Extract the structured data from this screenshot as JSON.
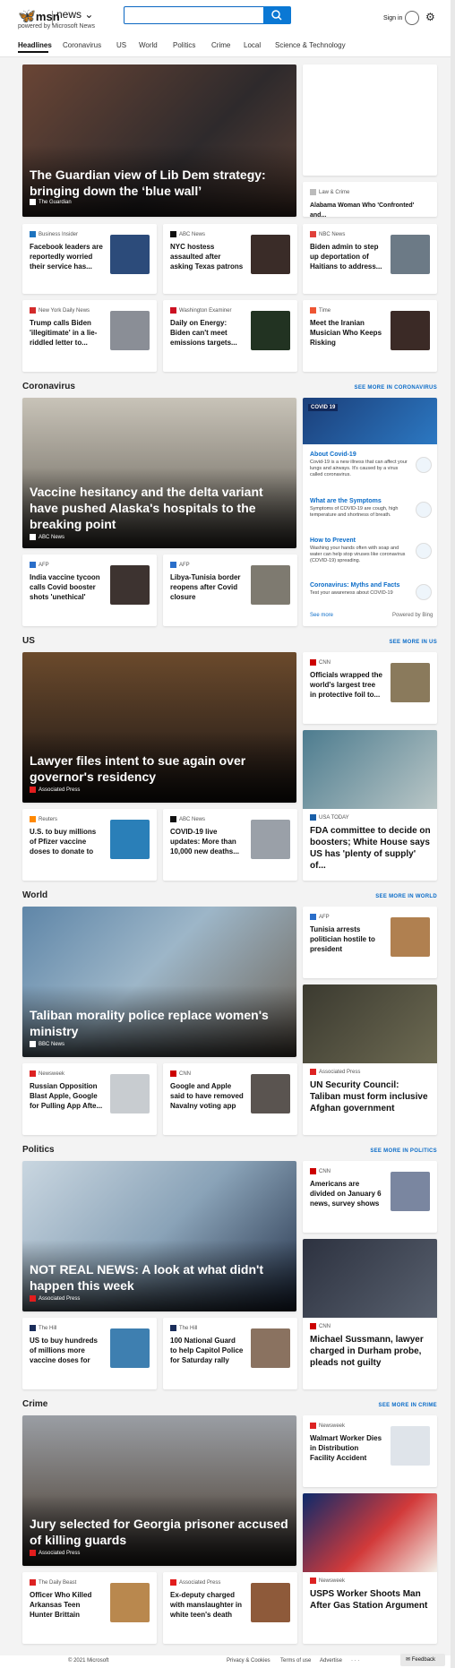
{
  "header": {
    "logo_brand": "msn",
    "logo_section": "news",
    "powered_by": "powered by Microsoft News",
    "search_value": "",
    "signin": "Sign in"
  },
  "nav": [
    "Headlines",
    "Coronavirus",
    "US",
    "World",
    "Politics",
    "Crime",
    "Local",
    "Science & Technology"
  ],
  "top": {
    "hero": {
      "title": "The Guardian view of Lib Dem strategy: bringing down the ‘blue wall’",
      "source": "The Guardian"
    },
    "side": {
      "source": "Law & Crime",
      "title": "Alabama Woman Who 'Confronted' and..."
    },
    "cards": [
      {
        "source": "Business Insider",
        "title": "Facebook leaders are reportedly worried their service has..."
      },
      {
        "source": "ABC News",
        "title": "NYC hostess assaulted after asking Texas patrons for proof of..."
      },
      {
        "source": "NBC News",
        "title": "Biden admin to step up deportation of Haitians to address..."
      },
      {
        "source": "New York Daily News",
        "title": "Trump calls Biden 'illegitimate' in a lie-riddled letter to..."
      },
      {
        "source": "Washington Examiner",
        "title": "Daily on Energy: Biden can't meet emissions targets..."
      },
      {
        "source": "Time",
        "title": "Meet the Iranian Musician Who Keeps Risking Imprisonme..."
      }
    ]
  },
  "coronavirus": {
    "heading": "Coronavirus",
    "see_more": "SEE MORE IN CORONAVIRUS",
    "hero": {
      "title": "Vaccine hesitancy and the delta variant have pushed Alaska's hospitals to the breaking point",
      "source": "ABC News"
    },
    "cards": [
      {
        "source": "AFP",
        "title": "India vaccine tycoon calls Covid booster shots 'unethical'"
      },
      {
        "source": "AFP",
        "title": "Libya-Tunisia border reopens after Covid closure"
      }
    ],
    "panel": {
      "badge": "COVID 19",
      "items": [
        {
          "h": "About Covid-19",
          "d": "Covid-19 is a new illness that can affect your lungs and airways. It's caused by a virus called coronavirus."
        },
        {
          "h": "What are the Symptoms",
          "d": "Symptoms of COVID-19 are cough, high temperature and shortness of breath."
        },
        {
          "h": "How to Prevent",
          "d": "Washing your hands often with soap and water can help stop viruses like coronavirus (COVID-19) spreading."
        },
        {
          "h": "Coronavirus: Myths and Facts",
          "d": "Test your awareness about COVID-19"
        }
      ],
      "see_more": "See more",
      "powered": "Powered by Bing"
    }
  },
  "us": {
    "heading": "US",
    "see_more": "SEE MORE IN US",
    "hero": {
      "title": "Lawyer files intent to sue again over governor's residency",
      "source": "Associated Press"
    },
    "side1": {
      "source": "CNN",
      "title": "Officials wrapped the world's largest tree in protective foil to..."
    },
    "side2": {
      "source": "USA TODAY",
      "title": "FDA committee to decide on boosters; White House says US has 'plenty of supply' of..."
    },
    "cards": [
      {
        "source": "Reuters",
        "title": "U.S. to buy millions of Pfizer vaccine doses to donate to world -..."
      },
      {
        "source": "ABC News",
        "title": "COVID-19 live updates: More than 10,000 new deaths..."
      }
    ]
  },
  "world": {
    "heading": "World",
    "see_more": "SEE MORE IN WORLD",
    "hero": {
      "title": "Taliban morality police replace women's ministry",
      "source": "BBC News"
    },
    "side1": {
      "source": "AFP",
      "title": "Tunisia arrests politician hostile to president"
    },
    "side2": {
      "source": "Associated Press",
      "title": "UN Security Council: Taliban must form inclusive Afghan government"
    },
    "cards": [
      {
        "source": "Newsweek",
        "title": "Russian Opposition Blast Apple, Google for Pulling App Afte..."
      },
      {
        "source": "CNN",
        "title": "Google and Apple said to have removed Navalny voting app ..."
      }
    ]
  },
  "politics": {
    "heading": "Politics",
    "see_more": "SEE MORE IN POLITICS",
    "hero": {
      "title": "NOT REAL NEWS: A look at what didn't happen this week",
      "source": "Associated Press"
    },
    "side1": {
      "source": "CNN",
      "title": "Americans are divided on January 6 news, survey shows"
    },
    "side2": {
      "source": "CNN",
      "title": "Michael Sussmann, lawyer charged in Durham probe, pleads not guilty"
    },
    "cards": [
      {
        "source": "The Hill",
        "title": "US to buy hundreds of millions more vaccine doses for th..."
      },
      {
        "source": "The Hill",
        "title": "100 National Guard to help Capitol Police for Saturday rally"
      }
    ]
  },
  "crime": {
    "heading": "Crime",
    "see_more": "SEE MORE IN CRIME",
    "hero": {
      "title": "Jury selected for Georgia prisoner accused of killing guards",
      "source": "Associated Press"
    },
    "side1": {
      "source": "Newsweek",
      "title": "Walmart Worker Dies in Distribution Facility Accident"
    },
    "side2": {
      "source": "Newsweek",
      "title": "USPS Worker Shoots Man After Gas Station Argument"
    },
    "cards": [
      {
        "source": "The Daily Beast",
        "title": "Officer Who Killed Arkansas Teen Hunter Brittain Charged Wit..."
      },
      {
        "source": "Associated Press",
        "title": "Ex-deputy charged with manslaughter in white teen's death"
      }
    ]
  },
  "footer": {
    "copyright": "© 2021 Microsoft",
    "privacy": "Privacy & Cookies",
    "terms": "Terms of use",
    "advertise": "Advertise",
    "more": "· · ·",
    "feedback": "Feedback"
  }
}
